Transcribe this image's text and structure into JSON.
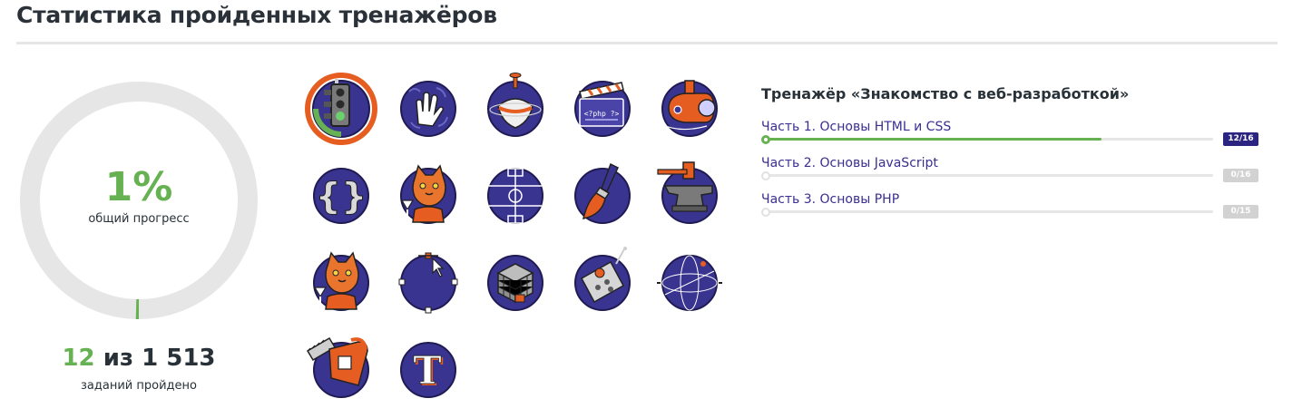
{
  "header": {
    "title": "Статистика пройденных тренажёров"
  },
  "progress": {
    "percent_text": "1%",
    "label": "общий прогресс",
    "fraction": 0.0079,
    "tasks_done": "12",
    "separator": "из",
    "tasks_total": "1 513",
    "tasks_label": "заданий пройдено"
  },
  "colors": {
    "accent_green": "#66b252",
    "brand_violet": "#3a3491",
    "badge_navy": "#2b2480",
    "orange": "#e65d22",
    "ring_gray": "#e6e6e6"
  },
  "badges": [
    {
      "id": "traffic-light",
      "icon": "traffic-light-icon",
      "active": true
    },
    {
      "id": "hand",
      "icon": "hand-icon",
      "active": false
    },
    {
      "id": "spinning-top",
      "icon": "spinning-top-icon",
      "active": false
    },
    {
      "id": "php-clapper",
      "icon": "php-clapperboard-icon",
      "active": false
    },
    {
      "id": "submarine",
      "icon": "submarine-icon",
      "active": false
    },
    {
      "id": "braces",
      "icon": "curly-braces-icon",
      "active": false
    },
    {
      "id": "cat-wine",
      "icon": "cat-with-glass-icon",
      "active": false
    },
    {
      "id": "football-field",
      "icon": "football-field-icon",
      "active": false
    },
    {
      "id": "paint-brush",
      "icon": "paint-brush-icon",
      "active": false
    },
    {
      "id": "anvil",
      "icon": "anvil-icon",
      "active": false
    },
    {
      "id": "cat-glass-2",
      "icon": "cat-with-glass-icon",
      "active": false
    },
    {
      "id": "vector-path",
      "icon": "vector-path-icon",
      "active": false
    },
    {
      "id": "cube",
      "icon": "rubik-cube-icon",
      "active": false
    },
    {
      "id": "remote",
      "icon": "remote-control-icon",
      "active": false
    },
    {
      "id": "sphere",
      "icon": "sphere-orbit-icon",
      "active": false
    },
    {
      "id": "chainsaw",
      "icon": "chainsaw-icon",
      "active": false
    },
    {
      "id": "typography",
      "icon": "letter-t-icon",
      "active": false
    }
  ],
  "course": {
    "title": "Тренажёр «Знакомство с веб-разработкой»",
    "parts": [
      {
        "name": "Часть 1. Основы HTML и CSS",
        "progress": "12/16",
        "done": 12,
        "total": 16,
        "active": true
      },
      {
        "name": "Часть 2. Основы JavaScript",
        "progress": "0/16",
        "done": 0,
        "total": 16,
        "active": false
      },
      {
        "name": "Часть 3. Основы PHP",
        "progress": "0/15",
        "done": 0,
        "total": 15,
        "active": false
      }
    ]
  }
}
